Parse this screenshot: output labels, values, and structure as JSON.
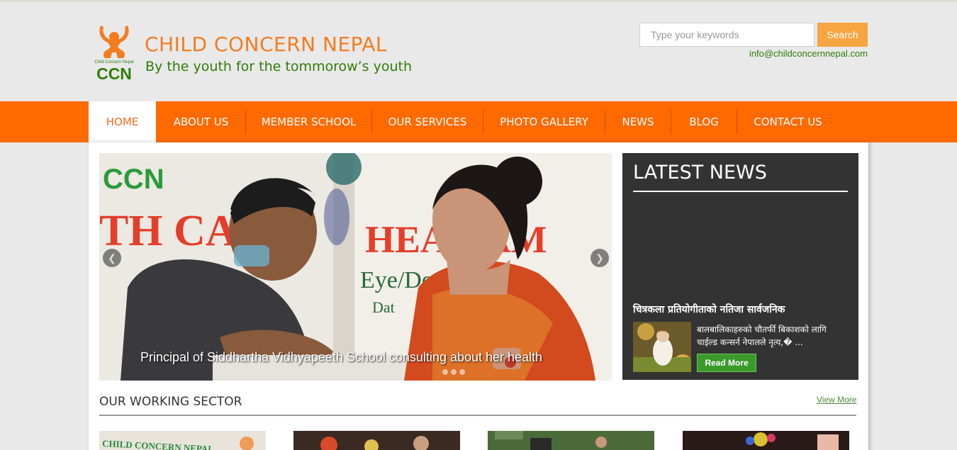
{
  "header": {
    "logo_text": "CCN",
    "logo_subtext": "Child Concern Nepal",
    "title": "CHILD CONCERN NEPAL",
    "tagline": "By the youth for the tommorow’s youth",
    "email": "info@childconcernnepal.com"
  },
  "search": {
    "placeholder": "Type your keywords",
    "button_label": "Search"
  },
  "nav": {
    "items": [
      {
        "label": "HOME",
        "active": true
      },
      {
        "label": "ABOUT US"
      },
      {
        "label": "MEMBER SCHOOL"
      },
      {
        "label": "OUR SERVICES"
      },
      {
        "label": "PHOTO GALLERY"
      },
      {
        "label": "NEWS"
      },
      {
        "label": "BLOG"
      },
      {
        "label": "CONTACT US"
      }
    ]
  },
  "slider": {
    "caption": "Principal of Siddhartha Vidhyapeeth School consulting about her health",
    "prev_icon": "chevron-left-icon",
    "next_icon": "chevron-right-icon",
    "banner_left": "CCN",
    "banner_left_2": "TH CA",
    "banner_right": "HEA  CAM",
    "banner_right_2": "Eye/Den",
    "banner_right_3": "Dat"
  },
  "latest_news": {
    "heading": "LATEST NEWS",
    "item_title": "चित्रकला प्रतियोगीताको नतिजा सार्वजनिक",
    "item_excerpt": "बालबालिकाहरुको चौतर्फी बिकाशको लागि चाईल्ड कन्सर्न नेपालले नृत्य,� ...",
    "read_more_label": "Read More"
  },
  "working_sector": {
    "heading": "OUR WORKING SECTOR",
    "view_more_label": "View More",
    "thumb_text": "CHILD CONCERN NEPAL"
  },
  "colors": {
    "brand_orange": "#ff6a00",
    "brand_green": "#2e7d0a",
    "search_button": "#f7a541",
    "news_bg": "#333333"
  }
}
